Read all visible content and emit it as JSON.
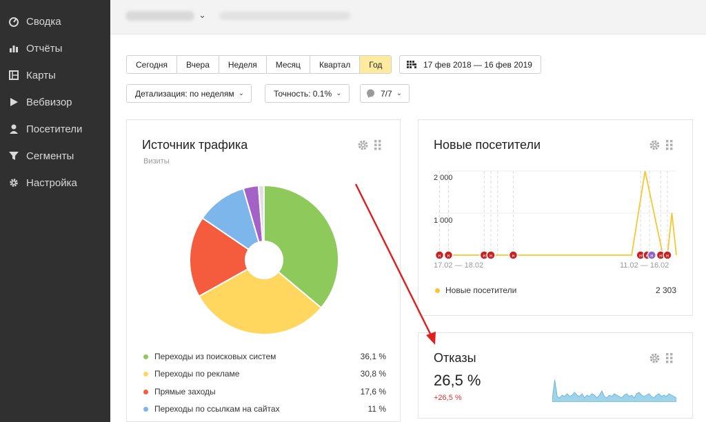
{
  "sidebar": {
    "items": [
      {
        "label": "Сводка",
        "icon": "dashboard-icon"
      },
      {
        "label": "Отчёты",
        "icon": "bar-chart-icon"
      },
      {
        "label": "Карты",
        "icon": "map-icon"
      },
      {
        "label": "Вебвизор",
        "icon": "play-icon"
      },
      {
        "label": "Посетители",
        "icon": "user-icon"
      },
      {
        "label": "Сегменты",
        "icon": "filter-icon"
      },
      {
        "label": "Настройка",
        "icon": "gear-icon"
      }
    ]
  },
  "periods": [
    "Сегодня",
    "Вчера",
    "Неделя",
    "Месяц",
    "Квартал",
    "Год"
  ],
  "active_period": "Год",
  "date_range": "17 фев 2018 — 16 фев 2019",
  "controls": {
    "detail": "Детализация: по неделям",
    "accuracy": "Точность: 0.1%",
    "segments": "7/7"
  },
  "traffic_widget": {
    "title": "Источник трафика",
    "subtitle": "Визиты",
    "legend": [
      {
        "label": "Переходы из поисковых систем",
        "value": "36,1 %",
        "color": "#8ec95c"
      },
      {
        "label": "Переходы по рекламе",
        "value": "30,8 %",
        "color": "#ffd75e"
      },
      {
        "label": "Прямые заходы",
        "value": "17,6 %",
        "color": "#f55c3e"
      },
      {
        "label": "Переходы по ссылкам на сайтах",
        "value": "11 %",
        "color": "#7cb6ea"
      }
    ]
  },
  "chart_data": [
    {
      "type": "pie",
      "title": "Источник трафика",
      "subtitle": "Визиты",
      "categories": [
        "Переходы из поисковых систем",
        "Переходы по рекламе",
        "Прямые заходы",
        "Переходы по ссылкам на сайтах",
        "",
        ""
      ],
      "values": [
        36.1,
        30.8,
        17.6,
        11,
        3.3,
        1.2
      ],
      "colors": [
        "#8ec95c",
        "#ffd75e",
        "#f55c3e",
        "#7cb6ea",
        "#a461c7",
        "#e0e0e0"
      ]
    },
    {
      "type": "line",
      "title": "Новые посетители",
      "ytick_labels": [
        "1 000",
        "2 000"
      ],
      "ylim": [
        0,
        2000
      ],
      "xlabel_start": "17.02 — 18.02",
      "xlabel_end": "11.02 — 16.02",
      "series": [
        {
          "name": "Новые посетители",
          "color": "#f7c630",
          "x": [
            0,
            10,
            20,
            30,
            36,
            40,
            44,
            47,
            51,
            52,
            53,
            54
          ],
          "values": [
            0,
            0,
            0,
            0,
            0,
            0,
            0,
            2000,
            0,
            0,
            1000,
            0
          ]
        }
      ],
      "total": "2 303"
    },
    {
      "type": "area",
      "title": "Отказы",
      "value": "26,5 %",
      "delta": "+26,5 %",
      "values": [
        2,
        16,
        4,
        3,
        5,
        4,
        6,
        4,
        5,
        7,
        5,
        4,
        6,
        3,
        5,
        4,
        6,
        5,
        3,
        5,
        8,
        4,
        3,
        5,
        4,
        6,
        5,
        4,
        3,
        5,
        6,
        4,
        5,
        3,
        6,
        7,
        5,
        4,
        5,
        6,
        4,
        3,
        5,
        6,
        4,
        5,
        4,
        6,
        5,
        4,
        3
      ]
    }
  ],
  "new_visitors_widget": {
    "title": "Новые посетители",
    "legend_label": "Новые посетители",
    "total": "2 303"
  },
  "bounce_widget": {
    "title": "Отказы",
    "value": "26,5 %",
    "delta": "+26,5 %"
  },
  "colors": {
    "sidebar_bg": "#303030",
    "active_period": "#ffeba0",
    "arrow": "#e02020"
  }
}
